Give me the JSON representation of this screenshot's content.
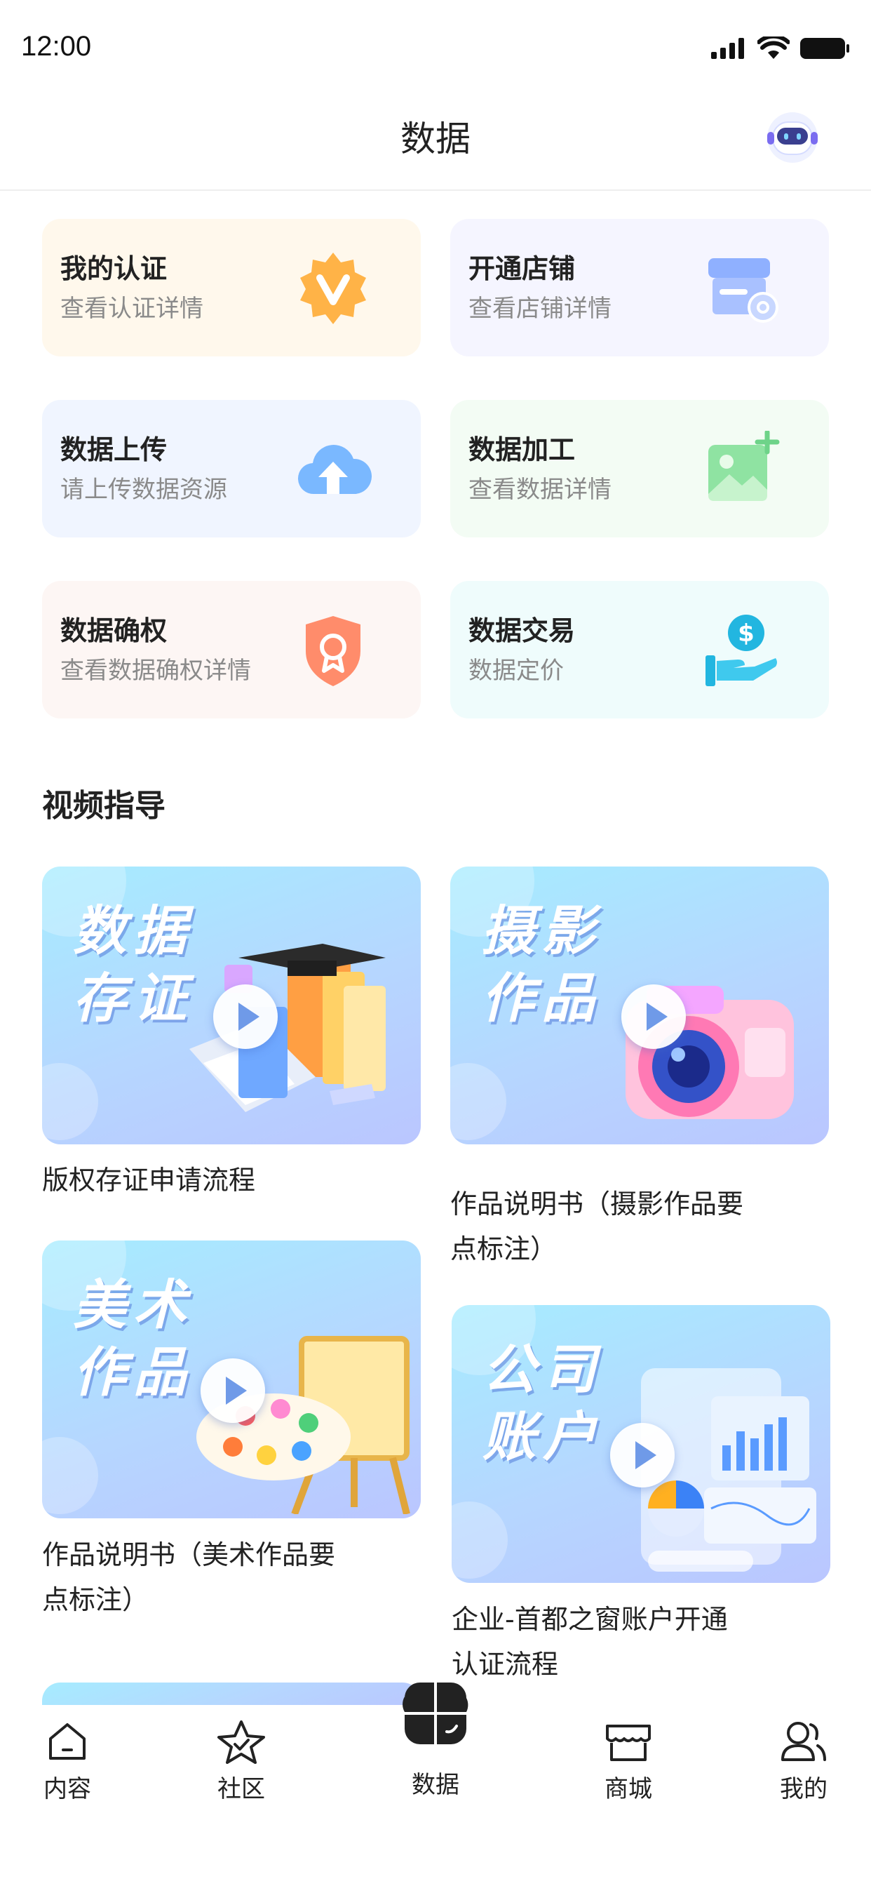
{
  "status_bar": {
    "time": "12:00"
  },
  "header": {
    "title": "数据"
  },
  "cards": [
    {
      "title": "我的认证",
      "subtitle": "查看认证详情",
      "icon": "verified-badge-icon",
      "bg": "#fff8ec"
    },
    {
      "title": "开通店铺",
      "subtitle": "查看店铺详情",
      "icon": "store-icon",
      "bg": "#f5f5ff"
    },
    {
      "title": "数据上传",
      "subtitle": "请上传数据资源",
      "icon": "cloud-upload-icon",
      "bg": "#f0f5ff"
    },
    {
      "title": "数据加工",
      "subtitle": "查看数据详情",
      "icon": "image-add-icon",
      "bg": "#f3fcf4"
    },
    {
      "title": "数据确权",
      "subtitle": "查看数据确权详情",
      "icon": "award-shield-icon",
      "bg": "#fdf6f4"
    },
    {
      "title": "数据交易",
      "subtitle": "数据定价",
      "icon": "dollar-hand-icon",
      "bg": "#effcfc"
    }
  ],
  "video_section": {
    "title": "视频指导",
    "videos": [
      {
        "banner_line1": "数据",
        "banner_line2": "存证",
        "caption": "版权存证申请流程"
      },
      {
        "banner_line1": "摄影",
        "banner_line2": "作品",
        "caption_line1": "作品说明书（摄影作品要",
        "caption_line2": "点标注）"
      },
      {
        "banner_line1": "美术",
        "banner_line2": "作品",
        "caption_line1": "作品说明书（美术作品要",
        "caption_line2": "点标注）"
      },
      {
        "banner_line1": "公司",
        "banner_line2": "账户",
        "caption_line1": "企业-首都之窗账户开通",
        "caption_line2": "认证流程"
      }
    ]
  },
  "tab_bar": {
    "items": [
      {
        "label": "内容",
        "icon": "home-icon"
      },
      {
        "label": "社区",
        "icon": "star-icon"
      },
      {
        "label": "数据",
        "icon": "data-clover-icon",
        "active": true
      },
      {
        "label": "商城",
        "icon": "shop-icon"
      },
      {
        "label": "我的",
        "icon": "user-icon"
      }
    ]
  },
  "colors": {
    "accent_blue": "#6f9ae8",
    "text": "#222222",
    "subtext": "#8a8a8a"
  }
}
